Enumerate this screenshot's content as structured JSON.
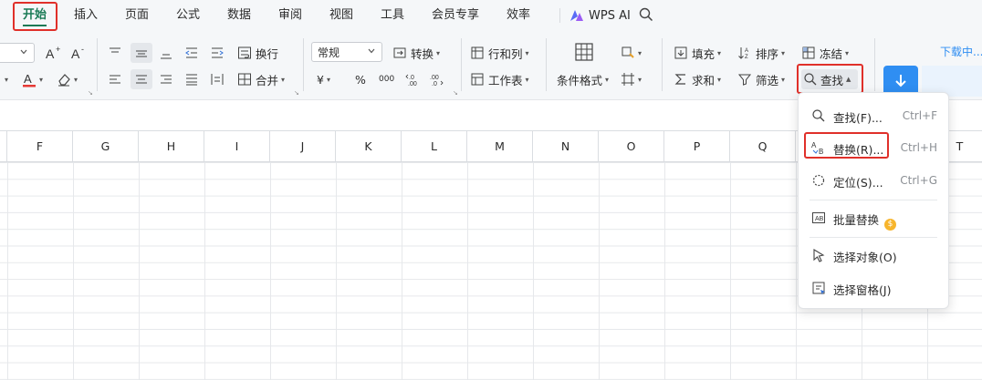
{
  "menu": {
    "tabs": [
      {
        "label": "开始",
        "active": true
      },
      {
        "label": "插入"
      },
      {
        "label": "页面"
      },
      {
        "label": "公式"
      },
      {
        "label": "数据"
      },
      {
        "label": "审阅"
      },
      {
        "label": "视图"
      },
      {
        "label": "工具"
      },
      {
        "label": "会员专享"
      },
      {
        "label": "效率"
      }
    ],
    "wps_ai": "WPS AI",
    "search_icon": "search-icon"
  },
  "ribbon": {
    "wrap_text": "换行",
    "merge": "合并",
    "number_format": "常规",
    "convert": "转换",
    "currency_symbol": "¥",
    "percent_symbol": "%",
    "thousands_symbol": "000",
    "rows_cols": "行和列",
    "worksheet": "工作表",
    "conditional_format": "条件格式",
    "fill": "填充",
    "sort": "排序",
    "freeze": "冻结",
    "sum": "求和",
    "filter": "筛选",
    "find": "查找",
    "download_status": "下载中..."
  },
  "grid": {
    "columns": [
      "F",
      "G",
      "H",
      "I",
      "J",
      "K",
      "L",
      "M",
      "N",
      "O",
      "P",
      "Q",
      "T"
    ]
  },
  "find_menu": {
    "items": [
      {
        "label": "查找(F)...",
        "shortcut": "Ctrl+F",
        "icon": "search-icon"
      },
      {
        "label": "替换(R)...",
        "shortcut": "Ctrl+H",
        "icon": "replace-icon",
        "highlighted": true
      },
      {
        "label": "定位(S)...",
        "shortcut": "Ctrl+G",
        "icon": "locate-icon"
      },
      {
        "label": "批量替换",
        "icon": "batch-replace-icon",
        "badge": "$"
      },
      {
        "label": "选择对象(O)",
        "icon": "select-object-icon"
      },
      {
        "label": "选择窗格(J)",
        "icon": "selection-pane-icon"
      }
    ]
  },
  "colors": {
    "accent_green": "#1a7b56",
    "highlight_red": "#e0302a",
    "download_blue": "#2f8ef2",
    "coin_gold": "#f7b52c"
  }
}
